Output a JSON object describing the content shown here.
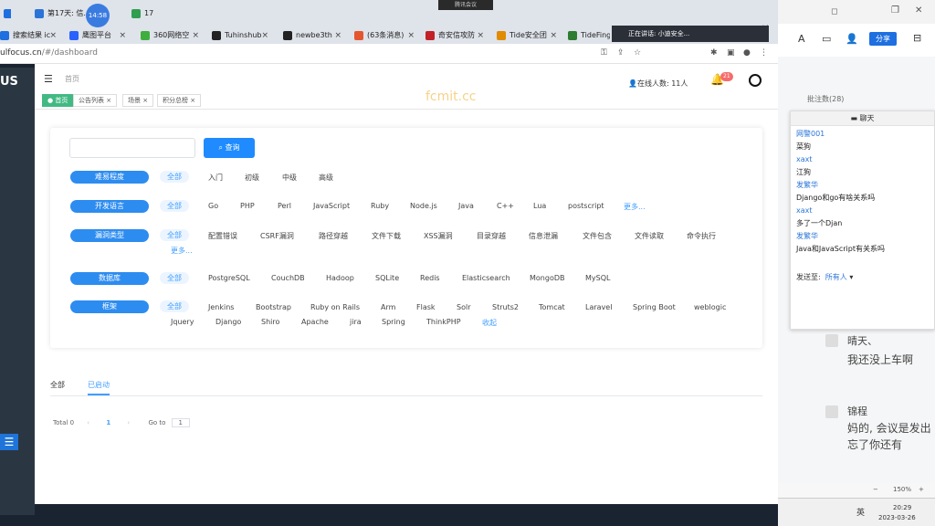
{
  "browser": {
    "tabs": [
      {
        "label": "搜索结果 ic",
        "color": "#1e6fe0"
      },
      {
        "label": "鹰图平台",
        "color": "#2962ff"
      },
      {
        "label": "360网络空",
        "color": "#3fae3f"
      },
      {
        "label": "Tuhinshub",
        "color": "#222222"
      },
      {
        "label": "newbe3th",
        "color": "#222222"
      },
      {
        "label": "(63条消息)",
        "color": "#e4572e"
      },
      {
        "label": "奇安信攻防",
        "color": "#c12127"
      },
      {
        "label": "Tide安全团",
        "color": "#e08b00"
      },
      {
        "label": "TideFinger",
        "color": "#2e7d32"
      }
    ],
    "top_tab_title": "第17天: 信...",
    "counter": "17",
    "meeting_label": "腾讯会议",
    "time_bubble": "14:58",
    "speaking": "正在讲话: 小迪安全...",
    "url_host": "ulfocus.cn",
    "url_path": "/#/dashboard"
  },
  "header": {
    "breadcrumb": "首页",
    "online": "在线人数: 11人",
    "bell_badge": "21",
    "watermark": "fcmit.cc"
  },
  "tags": [
    {
      "label": "首页",
      "active": true
    },
    {
      "label": "公告列表 ×",
      "active": false
    },
    {
      "label": "场景 ×",
      "active": false
    },
    {
      "label": "积分总榜 ×",
      "active": false
    }
  ],
  "search": {
    "button": "查询",
    "placeholder": ""
  },
  "filters": {
    "difficulty": {
      "label": "难易程度",
      "options": [
        "全部",
        "入门",
        "初级",
        "中级",
        "高级"
      ]
    },
    "language": {
      "label": "开发语言",
      "options": [
        "全部",
        "Go",
        "PHP",
        "Perl",
        "JavaScript",
        "Ruby",
        "Node.js",
        "Java",
        "C++",
        "Lua",
        "postscript"
      ],
      "more": "更多..."
    },
    "vuln": {
      "label": "漏洞类型",
      "options": [
        "全部",
        "配置错误",
        "CSRF漏洞",
        "路径穿越",
        "文件下载",
        "XSS漏洞",
        "目录穿越",
        "信息泄漏",
        "文件包含",
        "文件读取",
        "命令执行"
      ],
      "more": "更多..."
    },
    "db": {
      "label": "数据库",
      "options": [
        "全部",
        "PostgreSQL",
        "CouchDB",
        "Hadoop",
        "SQLite",
        "Redis",
        "Elasticsearch",
        "MongoDB",
        "MySQL"
      ]
    },
    "framework": {
      "label": "框架",
      "options": [
        "全部",
        "Jenkins",
        "Bootstrap",
        "Ruby on Rails",
        "Arm",
        "Flask",
        "Solr",
        "Struts2",
        "Tomcat",
        "Laravel",
        "Spring Boot",
        "weblogic",
        "Jquery",
        "Django",
        "Shiro",
        "Apache",
        "jira",
        "Spring",
        "ThinkPHP"
      ],
      "collapse": "收起"
    }
  },
  "page_tabs": [
    "全部",
    "已启动"
  ],
  "pager": {
    "total": "Total 0",
    "page": "1",
    "goto": "Go to",
    "goto_value": "1"
  },
  "side_app": {
    "share": "分享",
    "batch": "批注数(28)",
    "msg1_name": "晴天、",
    "msg1_text": "我还没上车啊",
    "msg2_name": "锦程",
    "msg2_text1": "妈的, 会议是发出",
    "msg2_text2": "忘了你还有",
    "zoom": "150%",
    "clock": "20:29",
    "date": "2023-03-26",
    "ime": "英"
  },
  "chat": {
    "title": "聊天",
    "messages": [
      {
        "name": "网警001",
        "text": "菜狗"
      },
      {
        "name": "xaxt",
        "text": "江狗"
      },
      {
        "name": "发繁华",
        "text": "Django和go有啥关系吗"
      },
      {
        "name": "xaxt",
        "text": "多了一个Djan"
      },
      {
        "name": "发繁华",
        "text": "Java和JavaScript有关系吗"
      }
    ],
    "send_to": "发送至:",
    "send_target": "所有人"
  },
  "left_logo": "US"
}
